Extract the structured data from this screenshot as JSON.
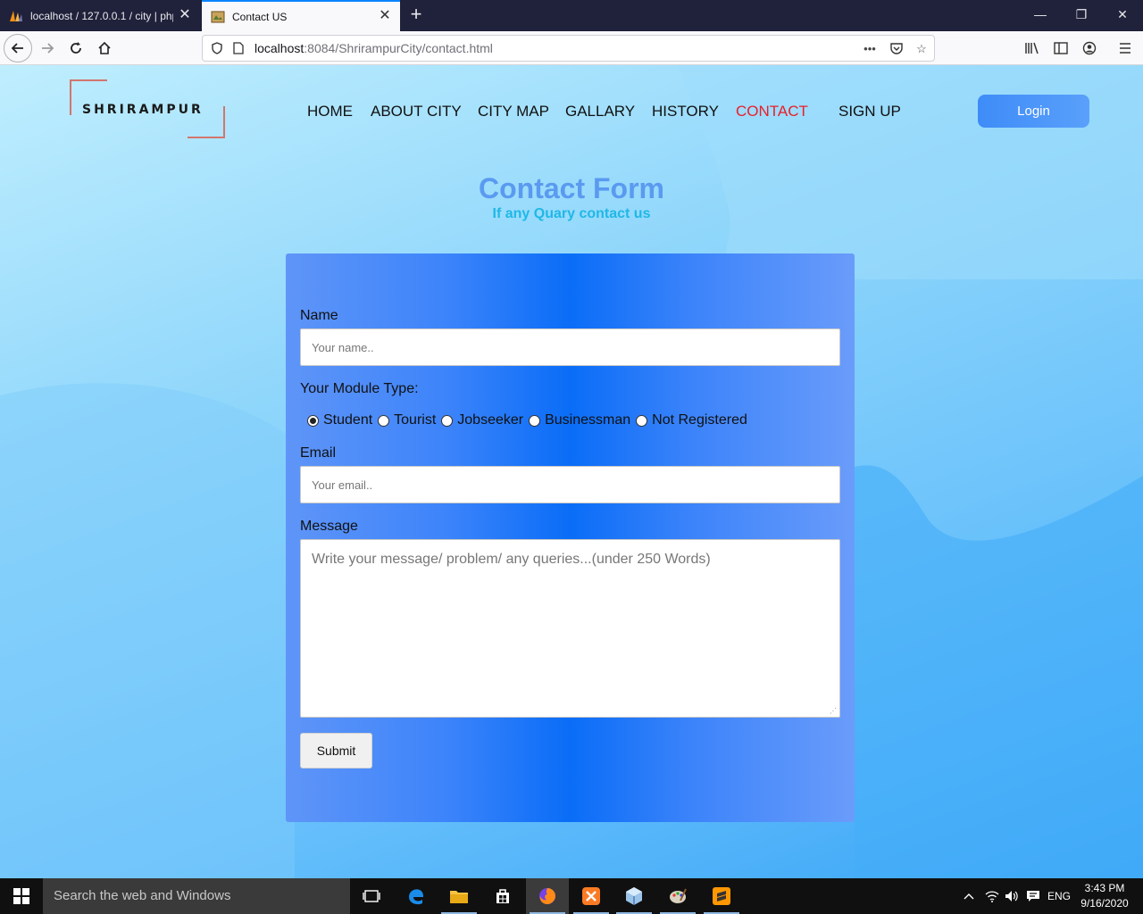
{
  "browser": {
    "tabs": [
      {
        "title": "localhost / 127.0.0.1 / city | php",
        "icon": "phpmyadmin-icon"
      },
      {
        "title": "Contact US",
        "icon": "site-favicon-icon"
      }
    ],
    "url_host": "localhost",
    "url_path": ":8084/ShrirampurCity/contact.html"
  },
  "site": {
    "logo": "SHRIRAMPUR",
    "nav": [
      "HOME",
      "ABOUT CITY",
      "CITY MAP",
      "GALLARY",
      "HISTORY",
      "CONTACT",
      "SIGN UP"
    ],
    "active_nav": "CONTACT",
    "login_label": "Login"
  },
  "contact": {
    "title": "Contact Form",
    "subtitle": "If any Quary contact us",
    "name_label": "Name",
    "name_placeholder": "Your name..",
    "module_label": "Your Module Type:",
    "module_options": [
      "Student",
      "Tourist",
      "Jobseeker",
      "Businessman",
      "Not Registered"
    ],
    "module_selected": "Student",
    "email_label": "Email",
    "email_placeholder": "Your email..",
    "message_label": "Message",
    "message_placeholder": "Write your message/ problem/ any queries...(under 250 Words)",
    "submit_label": "Submit"
  },
  "taskbar": {
    "search_placeholder": "Search the web and Windows",
    "lang": "ENG",
    "time": "3:43 PM",
    "date": "9/16/2020"
  },
  "colors": {
    "accent_red": "#e8202a",
    "heading_blue": "#5a9af0",
    "subheading_cyan": "#1fb8e6"
  }
}
